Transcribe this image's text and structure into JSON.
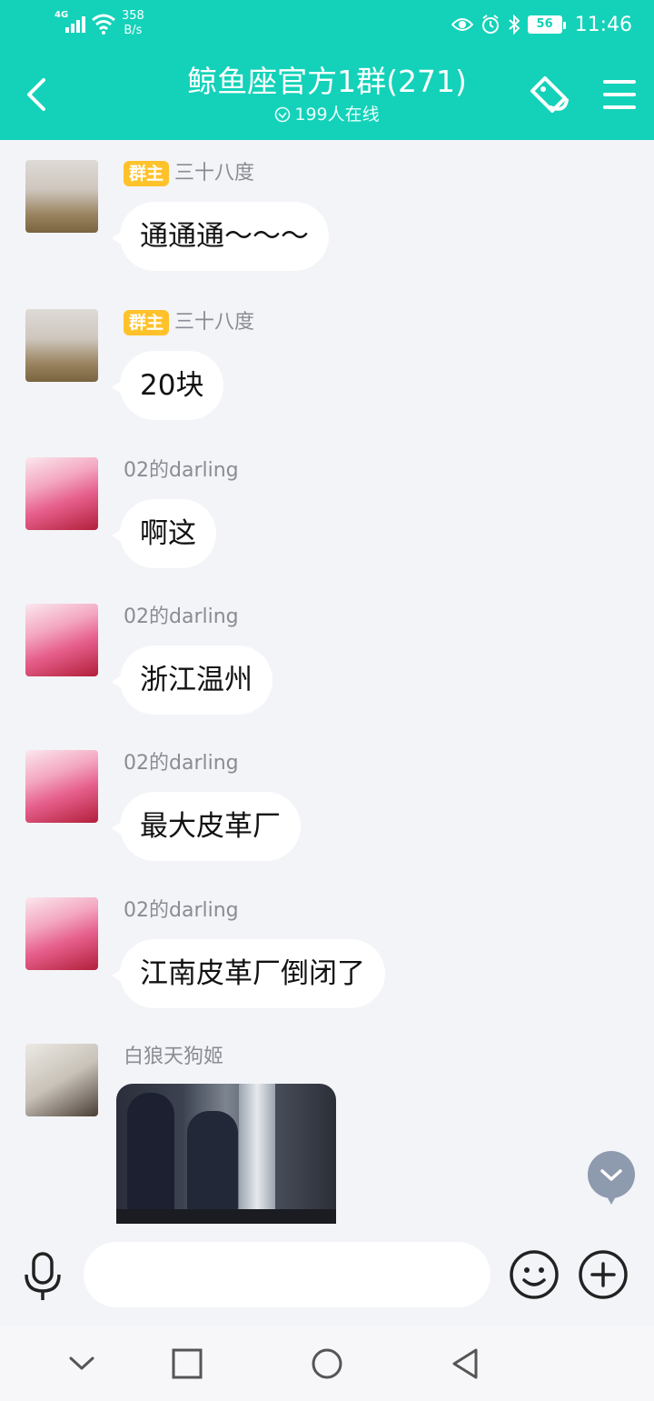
{
  "status_bar": {
    "network": "4G",
    "speed_value": "358",
    "speed_unit": "B/s",
    "battery": "56",
    "time": "11:46"
  },
  "header": {
    "title": "鲸鱼座官方1群(271)",
    "online": "199人在线",
    "back_icon": "chevron-left-icon",
    "tag_icon": "tag-icon",
    "menu_icon": "hamburger-menu-icon"
  },
  "messages": [
    {
      "badge": "群主",
      "sender": "三十八度",
      "text": "通通通～～～",
      "avatar": "brown-hair-glasses"
    },
    {
      "badge": "群主",
      "sender": "三十八度",
      "text": "20块",
      "avatar": "brown-hair-glasses"
    },
    {
      "badge": "",
      "sender": "02的darling",
      "text": "啊这",
      "avatar": "pink-hair-girl"
    },
    {
      "badge": "",
      "sender": "02的darling",
      "text": "浙江温州",
      "avatar": "pink-hair-girl"
    },
    {
      "badge": "",
      "sender": "02的darling",
      "text": "最大皮革厂",
      "avatar": "pink-hair-girl"
    },
    {
      "badge": "",
      "sender": "02的darling",
      "text": "江南皮革厂倒闭了",
      "avatar": "pink-hair-girl"
    },
    {
      "badge": "",
      "sender": "白狼天狗姬",
      "text": "",
      "avatar": "white-wolf-girl",
      "image": "submarine-crew-photo"
    }
  ],
  "input": {
    "placeholder": "",
    "mic_icon": "microphone-icon",
    "emoji_icon": "smiley-icon",
    "plus_icon": "plus-circle-icon"
  },
  "colors": {
    "accent": "#13d2b9",
    "badge": "#ffc22b",
    "background": "#f3f4f8",
    "bubble": "#ffffff"
  }
}
